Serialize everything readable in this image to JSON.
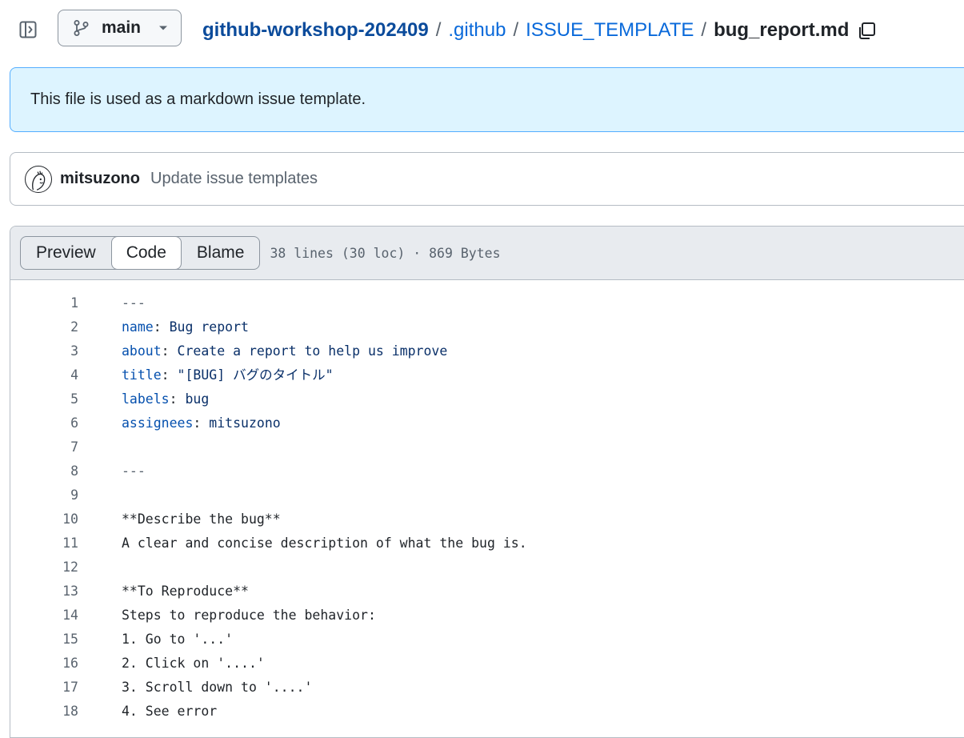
{
  "branch": {
    "label": "main"
  },
  "breadcrumb": {
    "repo": "github-workshop-202409",
    "dir1": ".github",
    "dir2": "ISSUE_TEMPLATE",
    "file": "bug_report.md",
    "separator": "/"
  },
  "flash": {
    "text": "This file is used as a markdown issue template."
  },
  "commit": {
    "author": "mitsuzono",
    "message": "Update issue templates"
  },
  "file_header": {
    "tabs": [
      "Preview",
      "Code",
      "Blame"
    ],
    "active_tab": "Code",
    "meta": "38 lines (30 loc) · 869 Bytes"
  },
  "code_lines": [
    {
      "n": "1",
      "text": "---"
    },
    {
      "n": "2",
      "key": "name",
      "value": " Bug report"
    },
    {
      "n": "3",
      "key": "about",
      "value": " Create a report to help us improve"
    },
    {
      "n": "4",
      "key": "title",
      "value": " \"[BUG] バグのタイトル\""
    },
    {
      "n": "5",
      "key": "labels",
      "value": " bug"
    },
    {
      "n": "6",
      "key": "assignees",
      "value": " mitsuzono"
    },
    {
      "n": "7",
      "text": ""
    },
    {
      "n": "8",
      "text": "---"
    },
    {
      "n": "9",
      "text": ""
    },
    {
      "n": "10",
      "text": "**Describe the bug**"
    },
    {
      "n": "11",
      "text": "A clear and concise description of what the bug is."
    },
    {
      "n": "12",
      "text": ""
    },
    {
      "n": "13",
      "text": "**To Reproduce**"
    },
    {
      "n": "14",
      "text": "Steps to reproduce the behavior:"
    },
    {
      "n": "15",
      "text": "1. Go to '...'"
    },
    {
      "n": "16",
      "text": "2. Click on '....'"
    },
    {
      "n": "17",
      "text": "3. Scroll down to '....'"
    },
    {
      "n": "18",
      "text": "4. See error"
    }
  ],
  "colors": {
    "link": "#0969da",
    "flash_bg": "#ddf4ff",
    "flash_border": "#54aeff",
    "header_bg": "#e8ebef"
  }
}
